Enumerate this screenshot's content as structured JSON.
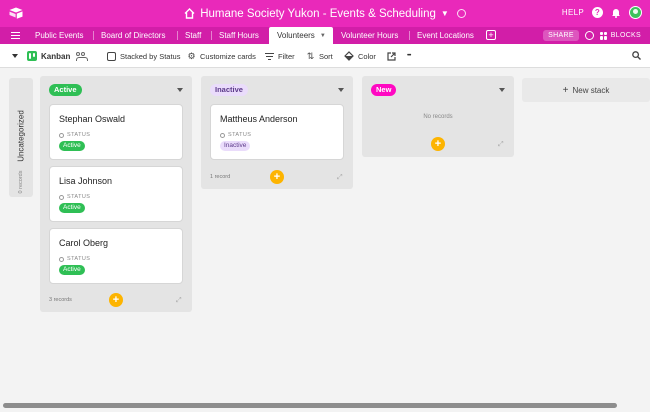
{
  "header": {
    "title": "Humane Society Yukon - Events & Scheduling",
    "help_label": "HELP"
  },
  "tabs": [
    {
      "label": "Public Events"
    },
    {
      "label": "Board of Directors"
    },
    {
      "label": "Staff"
    },
    {
      "label": "Staff Hours"
    },
    {
      "label": "Volunteers",
      "active": true
    },
    {
      "label": "Volunteer Hours"
    },
    {
      "label": "Event Locations"
    }
  ],
  "tabbar_right": {
    "share_label": "SHARE",
    "blocks_label": "BLOCKS"
  },
  "toolbar": {
    "view_name": "Kanban",
    "stacked_by": "Stacked by Status",
    "customize": "Customize cards",
    "filter": "Filter",
    "sort": "Sort",
    "color": "Color",
    "more": "•••"
  },
  "uncategorized": {
    "title": "Uncategorized",
    "count": "0 records"
  },
  "columns": [
    {
      "status": "Active",
      "footer": "3 records",
      "cards": [
        {
          "name": "Stephan Oswald",
          "field_label": "STATUS",
          "status": "Active"
        },
        {
          "name": "Lisa Johnson",
          "field_label": "STATUS",
          "status": "Active"
        },
        {
          "name": "Carol Oberg",
          "field_label": "STATUS",
          "status": "Active"
        }
      ]
    },
    {
      "status": "Inactive",
      "footer": "1 record",
      "cards": [
        {
          "name": "Mattheus Anderson",
          "field_label": "STATUS",
          "status": "Inactive"
        }
      ]
    },
    {
      "status": "New",
      "empty_text": "No records",
      "cards": []
    }
  ],
  "new_stack_label": "New stack",
  "colors": {
    "titlebar": "#e929ba",
    "tabbar": "#d21ea8",
    "active_pill": "#2fbf55",
    "inactive_pill": "#eadcfb",
    "new_pill": "#ff08c2",
    "add_button": "#fdb400"
  }
}
